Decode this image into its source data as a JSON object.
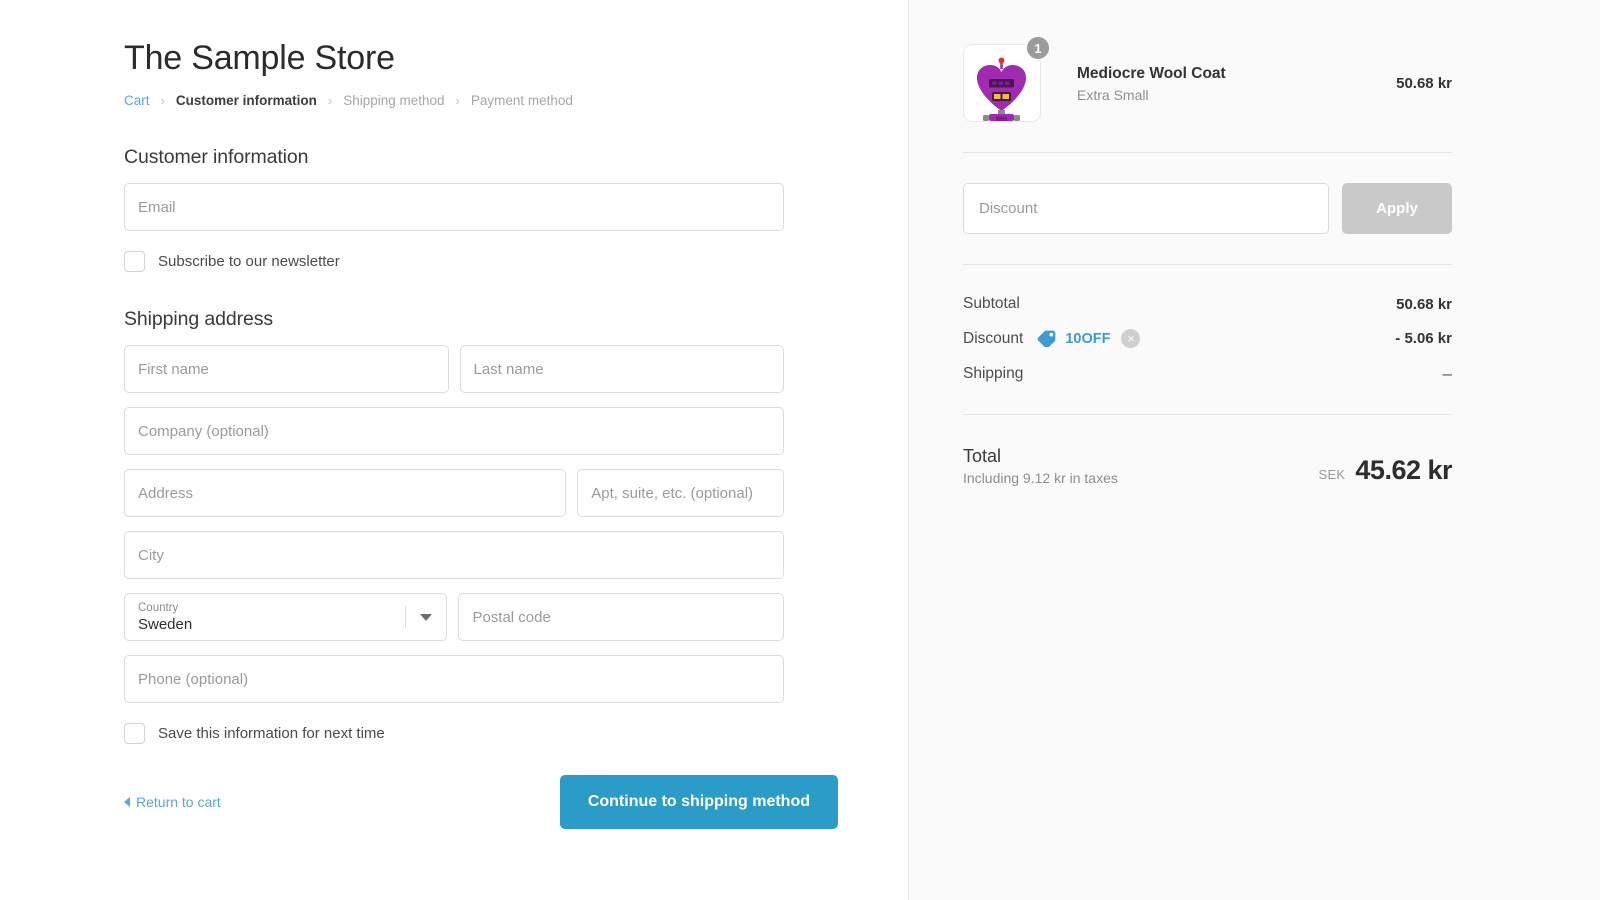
{
  "store": {
    "title": "The Sample Store"
  },
  "breadcrumb": {
    "cart": "Cart",
    "customer_information": "Customer information",
    "shipping_method": "Shipping method",
    "payment_method": "Payment method",
    "separator": "›"
  },
  "customer_section": {
    "heading": "Customer information",
    "email_placeholder": "Email",
    "newsletter_label": "Subscribe to our newsletter"
  },
  "shipping_section": {
    "heading": "Shipping address",
    "first_name_placeholder": "First name",
    "last_name_placeholder": "Last name",
    "company_placeholder": "Company (optional)",
    "address_placeholder": "Address",
    "apt_placeholder": "Apt, suite, etc. (optional)",
    "city_placeholder": "City",
    "country_label": "Country",
    "country_value": "Sweden",
    "postal_placeholder": "Postal code",
    "phone_placeholder": "Phone (optional)",
    "save_label": "Save this information for next time"
  },
  "actions": {
    "return_link": "Return to cart",
    "continue_label": "Continue to shipping method"
  },
  "summary": {
    "item": {
      "name": "Mediocre Wool Coat",
      "variant": "Extra Small",
      "price": "50.68 kr",
      "quantity": "1"
    },
    "discount_placeholder": "Discount",
    "apply_label": "Apply",
    "rows": [
      {
        "label": "Subtotal",
        "value": "50.68 kr"
      },
      {
        "label": "Discount",
        "value": "- 5.06 kr",
        "code": "10OFF"
      },
      {
        "label": "Shipping",
        "value": "–"
      }
    ],
    "total": {
      "label": "Total",
      "taxes_note": "Including 9.12 kr in taxes",
      "currency": "SEK",
      "amount": "45.62 kr"
    },
    "remove_glyph": "×"
  },
  "colors": {
    "accent_blue": "#2b9cc8",
    "link_blue": "#5aa7d8",
    "panel_bg": "#fafafa",
    "disabled_gray": "#c9c9c9"
  }
}
